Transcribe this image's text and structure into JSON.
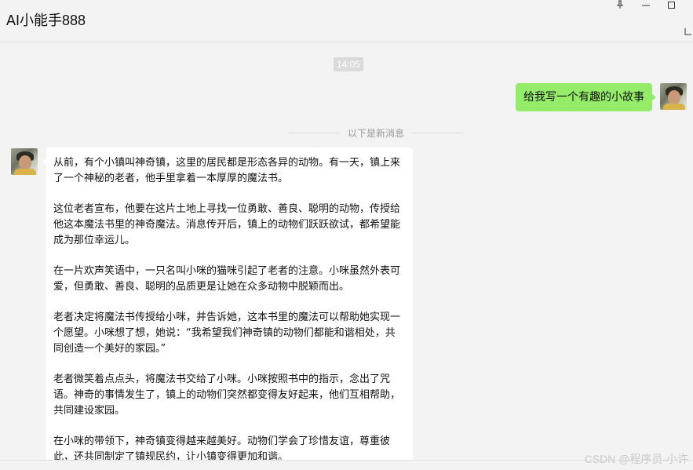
{
  "window": {
    "title": "AI小能手888"
  },
  "chat": {
    "timestamp": "14:05",
    "outgoing_message": "给我写一个有趣的小故事",
    "new_messages_divider": "以下是新消息",
    "incoming_paragraphs": [
      "从前，有个小镇叫神奇镇，这里的居民都是形态各异的动物。有一天，镇上来了一个神秘的老者，他手里拿着一本厚厚的魔法书。",
      "这位老者宣布，他要在这片土地上寻找一位勇敢、善良、聪明的动物，传授给他这本魔法书里的神奇魔法。消息传开后，镇上的动物们跃跃欲试，都希望能成为那位幸运儿。",
      "在一片欢声笑语中，一只名叫小咪的猫咪引起了老者的注意。小咪虽然外表可爱，但勇敢、善良、聪明的品质更是让她在众多动物中脱颖而出。",
      "老者决定将魔法书传授给小咪，并告诉她，这本书里的魔法可以帮助她实现一个愿望。小咪想了想，她说：“我希望我们神奇镇的动物们都能和谐相处，共同创造一个美好的家园。”",
      "老者微笑着点点头，将魔法书交给了小咪。小咪按照书中的指示，念出了咒语。神奇的事情发生了，镇上的动物们突然都变得友好起来，他们互相帮助，共同建设家园。",
      "在小咪的带领下，神奇镇变得越来越美好。动物们学会了珍惜友谊，尊重彼此，还共同制定了镇规民约，让小镇变得更加和谐。"
    ]
  },
  "watermark": "CSDN @程序员-小许",
  "colors": {
    "outgoing_bubble": "#95ec69",
    "incoming_bubble": "#ffffff",
    "background": "#f3f3f3"
  },
  "icons": {
    "pin": "pin-icon",
    "minimize": "minimize-icon",
    "maximize": "maximize-icon"
  }
}
